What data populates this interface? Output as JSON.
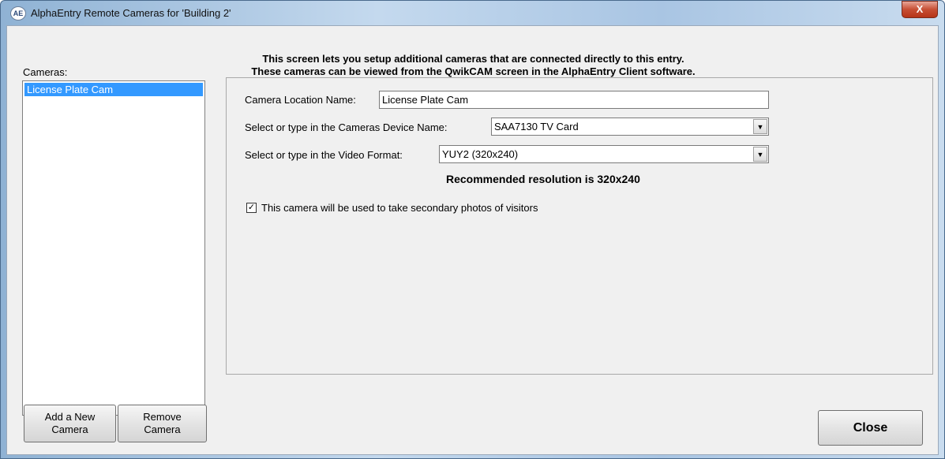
{
  "window": {
    "title": "AlphaEntry Remote Cameras for 'Building 2'",
    "app_icon": "AE",
    "close_glyph": "X"
  },
  "header": {
    "line1": "This screen lets you setup additional cameras that are connected directly to this entry.",
    "line2": "These cameras can be viewed from the QwikCAM screen in the AlphaEntry Client software."
  },
  "sidebar": {
    "label": "Cameras:",
    "items": [
      {
        "label": "License Plate Cam",
        "selected": true
      }
    ],
    "add_button": {
      "line1": "Add a New",
      "line2": "Camera"
    },
    "remove_button": {
      "line1": "Remove",
      "line2": "Camera"
    }
  },
  "form": {
    "location_label": "Camera Location Name:",
    "location_value": "License Plate Cam",
    "device_label": "Select or type in the Cameras Device Name:",
    "device_value": "SAA7130 TV Card",
    "format_label": "Select or type in the Video Format:",
    "format_value": "YUY2 (320x240)",
    "recommended": "Recommended resolution is 320x240",
    "secondary_label": "This camera will be used to take secondary photos of visitors",
    "secondary_checked": true,
    "check_glyph": "✓",
    "dropdown_glyph": "▼"
  },
  "footer": {
    "close_label": "Close"
  }
}
